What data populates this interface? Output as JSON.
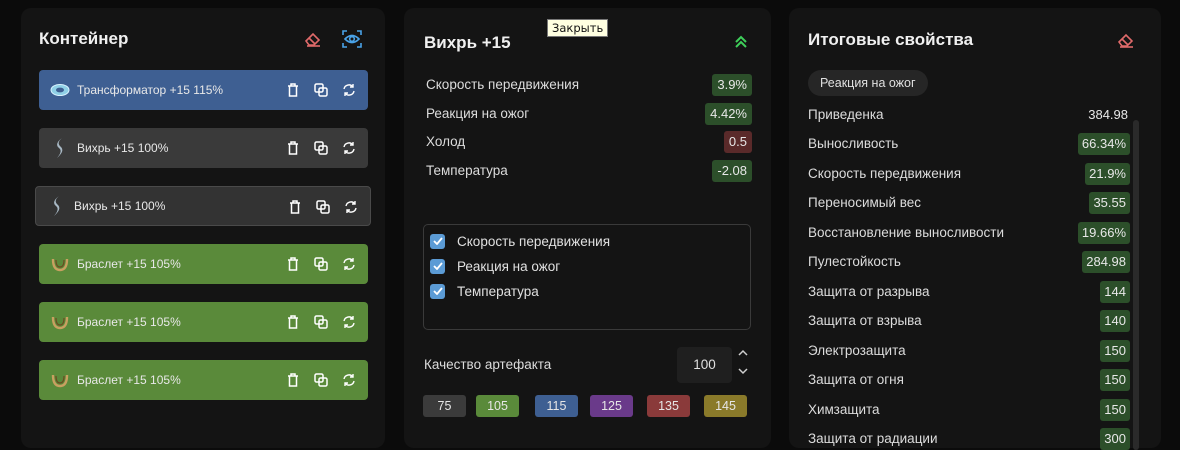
{
  "tooltip": "Закрыть",
  "container": {
    "title": "Контейнер",
    "items": [
      {
        "name": "Трансформатор",
        "level": "+15",
        "quality": "115%"
      },
      {
        "name": "Вихрь",
        "level": "+15",
        "quality": "100%"
      },
      {
        "name": "Вихрь",
        "level": "+15",
        "quality": "100%"
      },
      {
        "name": "Браслет",
        "level": "+15",
        "quality": "105%"
      },
      {
        "name": "Браслет",
        "level": "+15",
        "quality": "105%"
      },
      {
        "name": "Браслет",
        "level": "+15",
        "quality": "105%"
      }
    ]
  },
  "artifact": {
    "title": "Вихрь +15",
    "stats": [
      {
        "label": "Скорость передвижения",
        "value": "3.9%"
      },
      {
        "label": "Реакция на ожог",
        "value": "4.42%"
      },
      {
        "label": "Холод",
        "value": "0.5"
      },
      {
        "label": "Температура",
        "value": "-2.08"
      }
    ],
    "checks": [
      {
        "label": "Скорость передвижения",
        "checked": true
      },
      {
        "label": "Реакция на ожог",
        "checked": true
      },
      {
        "label": "Температура",
        "checked": true
      }
    ],
    "quality_label": "Качество артефакта",
    "quality_value": "100",
    "quality_buttons": [
      "75",
      "105",
      "115",
      "125",
      "135",
      "145"
    ],
    "quality_colors": [
      "#3b3b3b",
      "#5a8a3a",
      "#3e5f92",
      "#6a3a8a",
      "#8a3a3a",
      "#8a7a2a"
    ]
  },
  "totals": {
    "title": "Итоговые свойства",
    "tag": "Реакция на ожог",
    "rows": [
      {
        "label": "Приведенка",
        "value": "384.98",
        "highlight": false
      },
      {
        "label": "Выносливость",
        "value": "66.34%",
        "highlight": true
      },
      {
        "label": "Скорость передвижения",
        "value": "21.9%",
        "highlight": true
      },
      {
        "label": "Переносимый вес",
        "value": "35.55",
        "highlight": true
      },
      {
        "label": "Восстановление выносливости",
        "value": "19.66%",
        "highlight": true
      },
      {
        "label": "Пулестойкость",
        "value": "284.98",
        "highlight": true
      },
      {
        "label": "Защита от разрыва",
        "value": "144",
        "highlight": true
      },
      {
        "label": "Защита от взрыва",
        "value": "140",
        "highlight": true
      },
      {
        "label": "Электрозащита",
        "value": "150",
        "highlight": true
      },
      {
        "label": "Защита от огня",
        "value": "150",
        "highlight": true
      },
      {
        "label": "Химзащита",
        "value": "150",
        "highlight": true
      },
      {
        "label": "Защита от радиации",
        "value": "300",
        "highlight": true
      }
    ]
  }
}
